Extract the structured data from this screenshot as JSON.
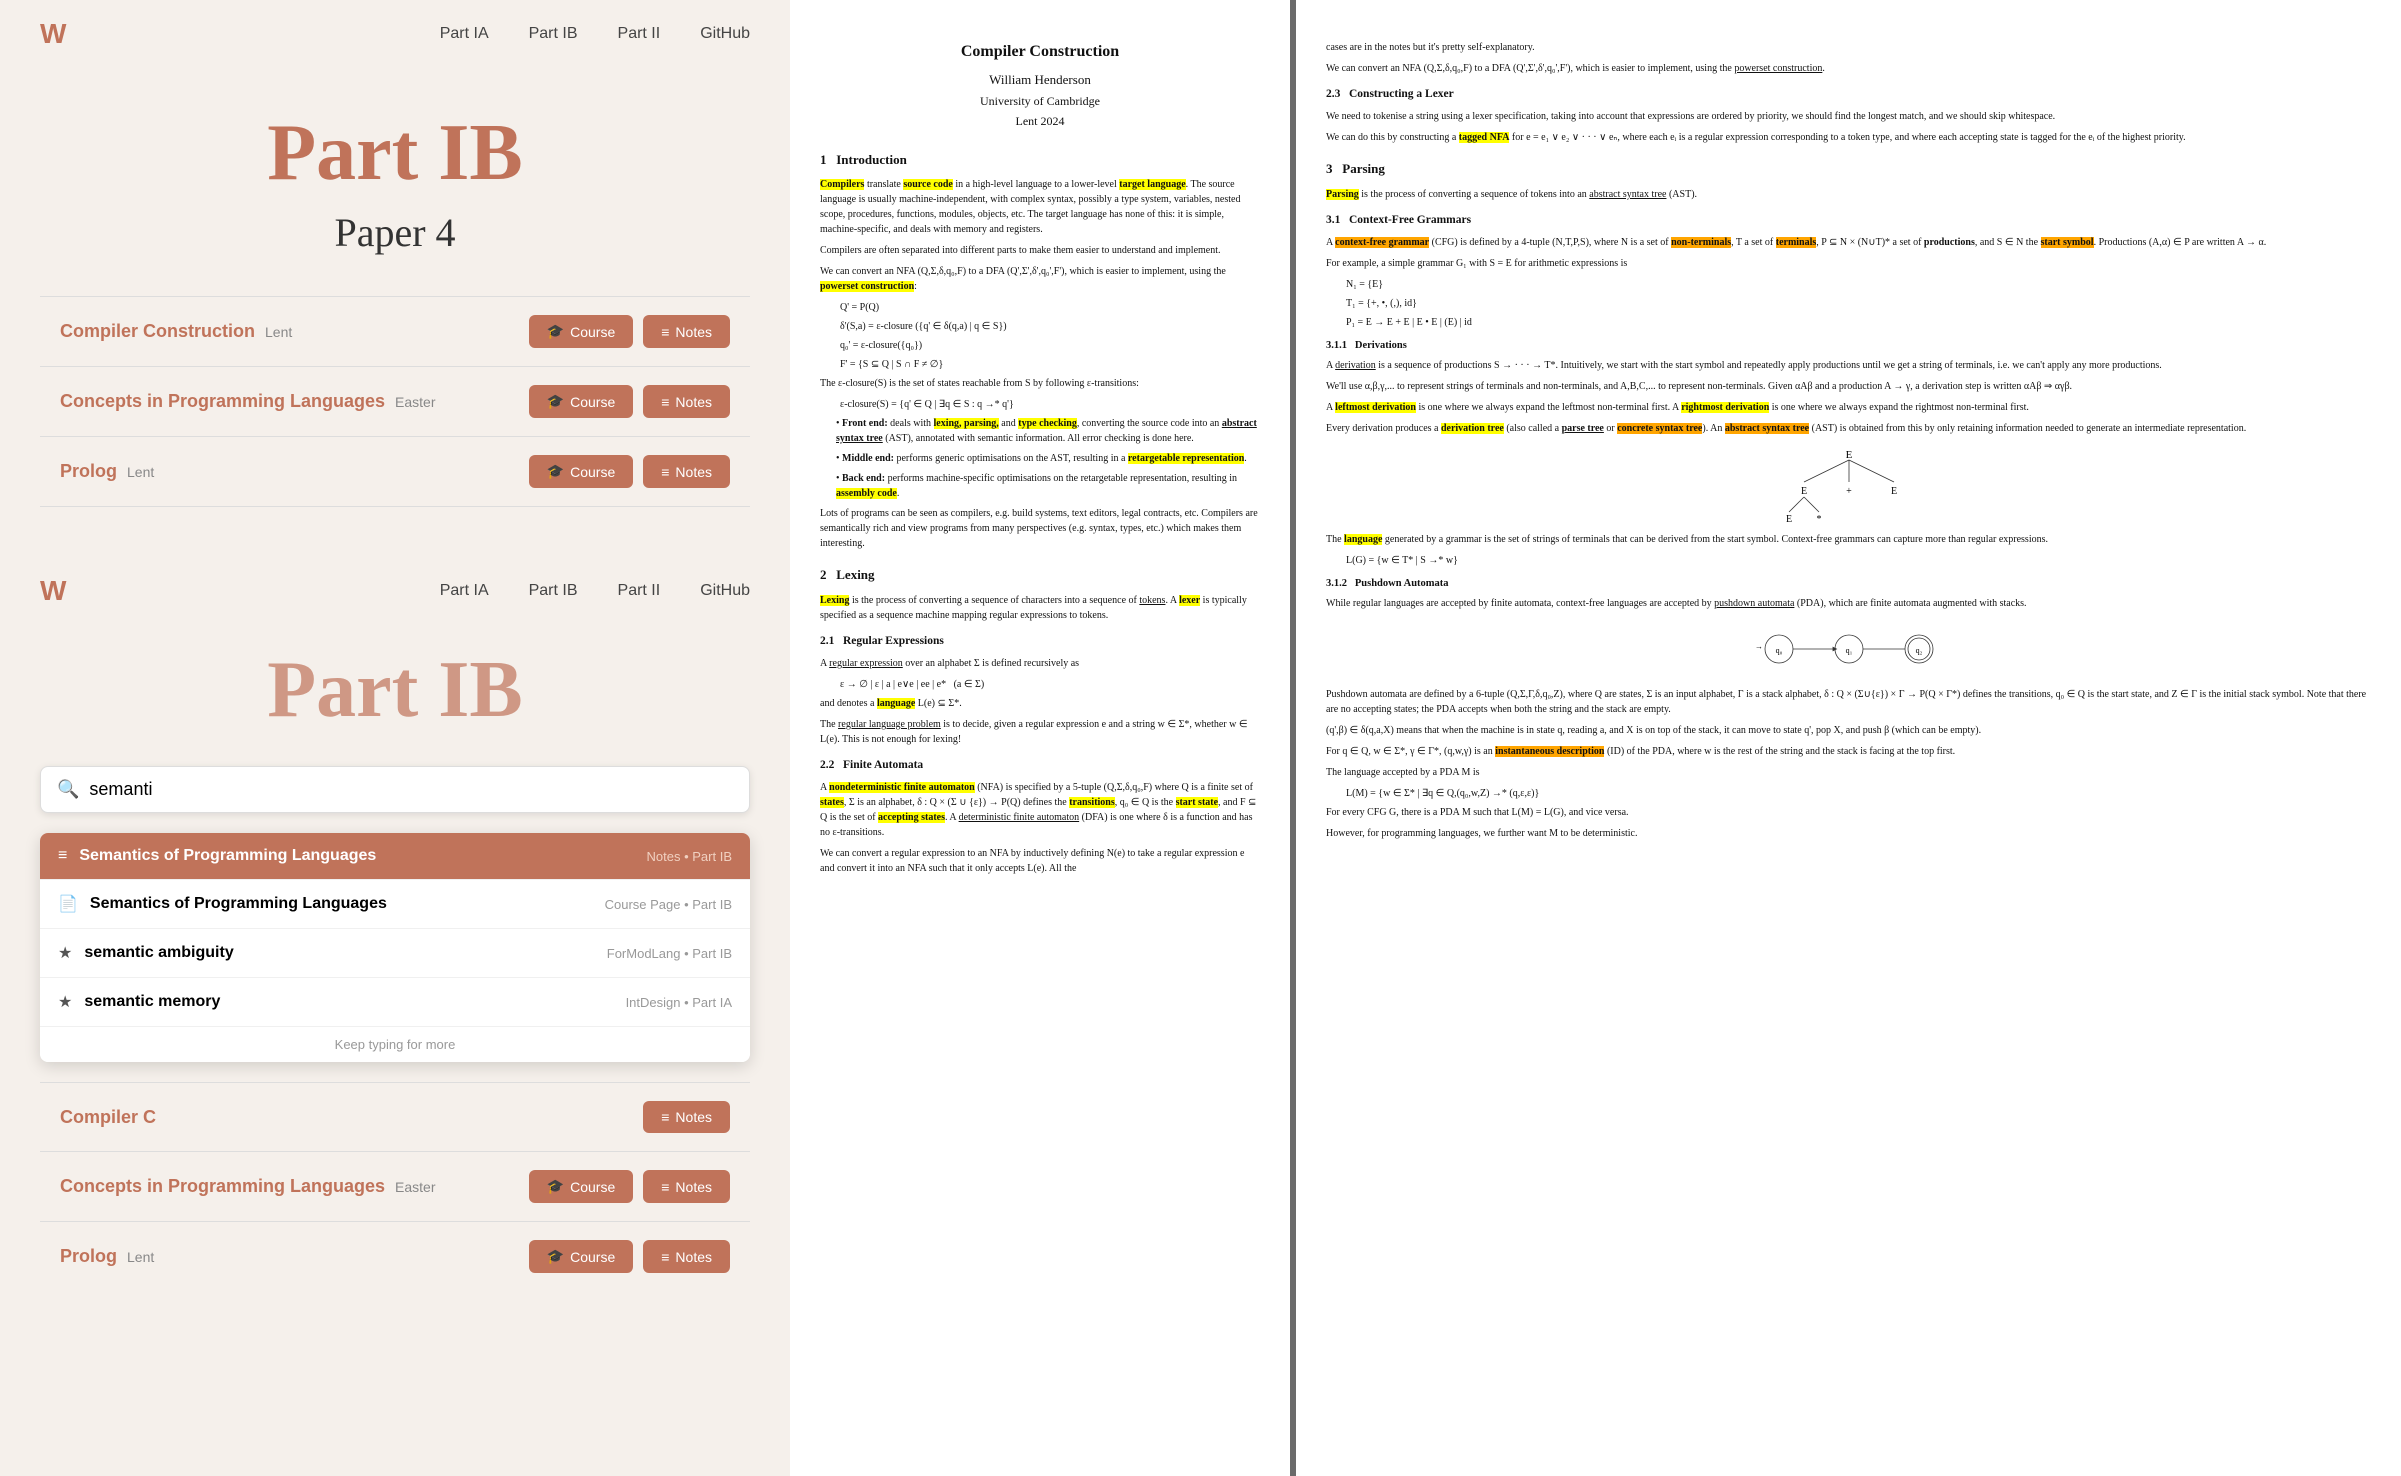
{
  "app": {
    "logo": "W",
    "nav": {
      "links": [
        "Part IA",
        "Part IB",
        "Part II",
        "GitHub"
      ]
    }
  },
  "top_section": {
    "hero": {
      "part": "Part IB",
      "paper": "Paper 4"
    },
    "courses": [
      {
        "name": "Compiler Construction",
        "term": "Lent",
        "course_label": "Course",
        "notes_label": "Notes"
      },
      {
        "name": "Concepts in Programming Languages",
        "term": "Easter",
        "course_label": "Course",
        "notes_label": "Notes"
      },
      {
        "name": "Prolog",
        "term": "Lent",
        "course_label": "Course",
        "notes_label": "Notes"
      }
    ]
  },
  "bottom_section": {
    "hero": {
      "part": "Part IB"
    },
    "search": {
      "placeholder": "semanti",
      "value": "semanti"
    },
    "results": [
      {
        "icon": "list",
        "name": "Semantics of Programming Languages",
        "meta": "Notes • Part IB",
        "highlighted": true
      },
      {
        "icon": "page",
        "name": "Semantics of Programming Languages",
        "meta": "Course Page • Part IB",
        "highlighted": false
      },
      {
        "icon": "star",
        "name": "semantic ambiguity",
        "meta": "ForModLang • Part IB",
        "highlighted": false
      },
      {
        "icon": "star",
        "name": "semantic memory",
        "meta": "IntDesign • Part IA",
        "highlighted": false
      }
    ],
    "keep_typing": "Keep typing for more",
    "bottom_courses": [
      {
        "name": "Compiler C",
        "term": "",
        "notes_label": "Notes"
      },
      {
        "name": "Concepts in Programming Languages",
        "term": "Easter",
        "course_label": "Course",
        "notes_label": "Notes"
      },
      {
        "name": "Prolog",
        "term": "Lent",
        "course_label": "Course",
        "notes_label": "Notes"
      }
    ]
  },
  "pdf": {
    "title": "Compiler Construction",
    "author": "William Henderson",
    "university": "University of Cambridge",
    "term": "Lent 2024",
    "sections": {
      "intro": "1   Introduction",
      "lexing": "2   Lexing",
      "reg_expr": "2.1   Regular Expressions",
      "finite_auto": "2.2   Finite Automata",
      "parsing": "3   Parsing",
      "context_free": "3.1   Context-Free Grammars",
      "derivations": "3.1.1   Derivations",
      "pushdown": "3.1.2   Pushdown Automata",
      "constructing_lexer": "2.3   Constructing a Lexer"
    }
  }
}
